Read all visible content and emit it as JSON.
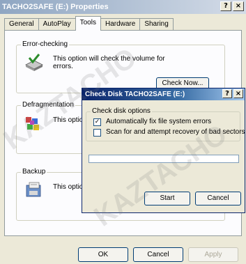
{
  "window": {
    "title": "TACHO2SAFE (E:) Properties",
    "help_btn": "?",
    "close_btn": "×"
  },
  "tabs": [
    {
      "label": "General",
      "active": false
    },
    {
      "label": "AutoPlay",
      "active": false
    },
    {
      "label": "Tools",
      "active": true
    },
    {
      "label": "Hardware",
      "active": false
    },
    {
      "label": "Sharing",
      "active": false
    }
  ],
  "error_checking": {
    "legend": "Error-checking",
    "text_line1": "This option will check the volume for",
    "text_line2": "errors.",
    "button": "Check Now..."
  },
  "defragmentation": {
    "legend": "Defragmentation",
    "text": "This option v"
  },
  "backup": {
    "legend": "Backup",
    "text": "This option v"
  },
  "footer": {
    "ok": "OK",
    "cancel": "Cancel",
    "apply": "Apply"
  },
  "dialog": {
    "title": "Check Disk TACHO2SAFE (E:)",
    "help_btn": "?",
    "close_btn": "×",
    "group_legend": "Check disk options",
    "option1": {
      "label": "Automatically fix file system errors",
      "checked": true
    },
    "option2": {
      "label": "Scan for and attempt recovery of bad sectors",
      "checked": false
    },
    "progress": 0,
    "start": "Start",
    "cancel": "Cancel"
  },
  "watermark": "KAZTACHO",
  "colors": {
    "xp_face": "#ece9d8",
    "dialog_title": "#0a246a",
    "button_border": "#003c74"
  },
  "icons": [
    "error-check-icon",
    "defrag-icon",
    "backup-icon",
    "check-mark-icon"
  ]
}
